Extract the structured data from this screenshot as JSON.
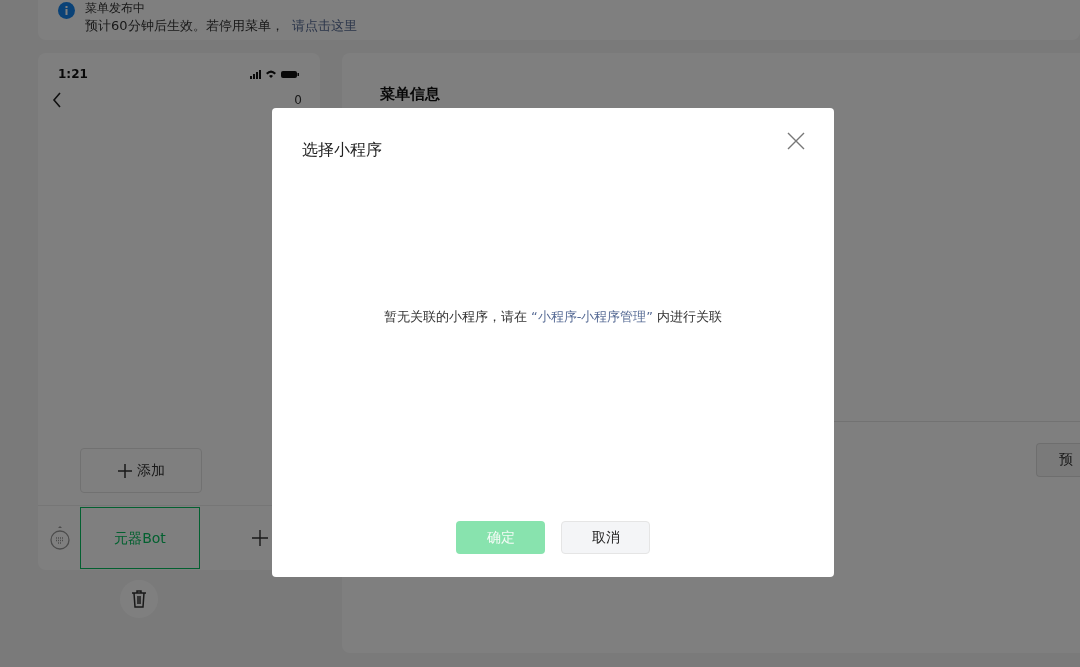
{
  "notice": {
    "title": "菜单发布中",
    "text": "预计60分钟后生效。若停用菜单，",
    "link": "请点击这里"
  },
  "phone": {
    "time": "1:21",
    "count": "0",
    "add_button": "添加",
    "menu_items": [
      {
        "label": "元器Bot",
        "selected": true
      }
    ]
  },
  "panel": {
    "title": "菜单信息",
    "button": "预"
  },
  "dialog": {
    "title": "选择小程序",
    "message": {
      "before": "暂无关联的小程序，请在",
      "link": "“小程序-小程序管理”",
      "after": "内进行关联"
    },
    "buttons": [
      {
        "label": "确定",
        "kind": "primary",
        "disabled": true
      },
      {
        "label": "取消",
        "kind": "default",
        "disabled": false
      }
    ]
  }
}
